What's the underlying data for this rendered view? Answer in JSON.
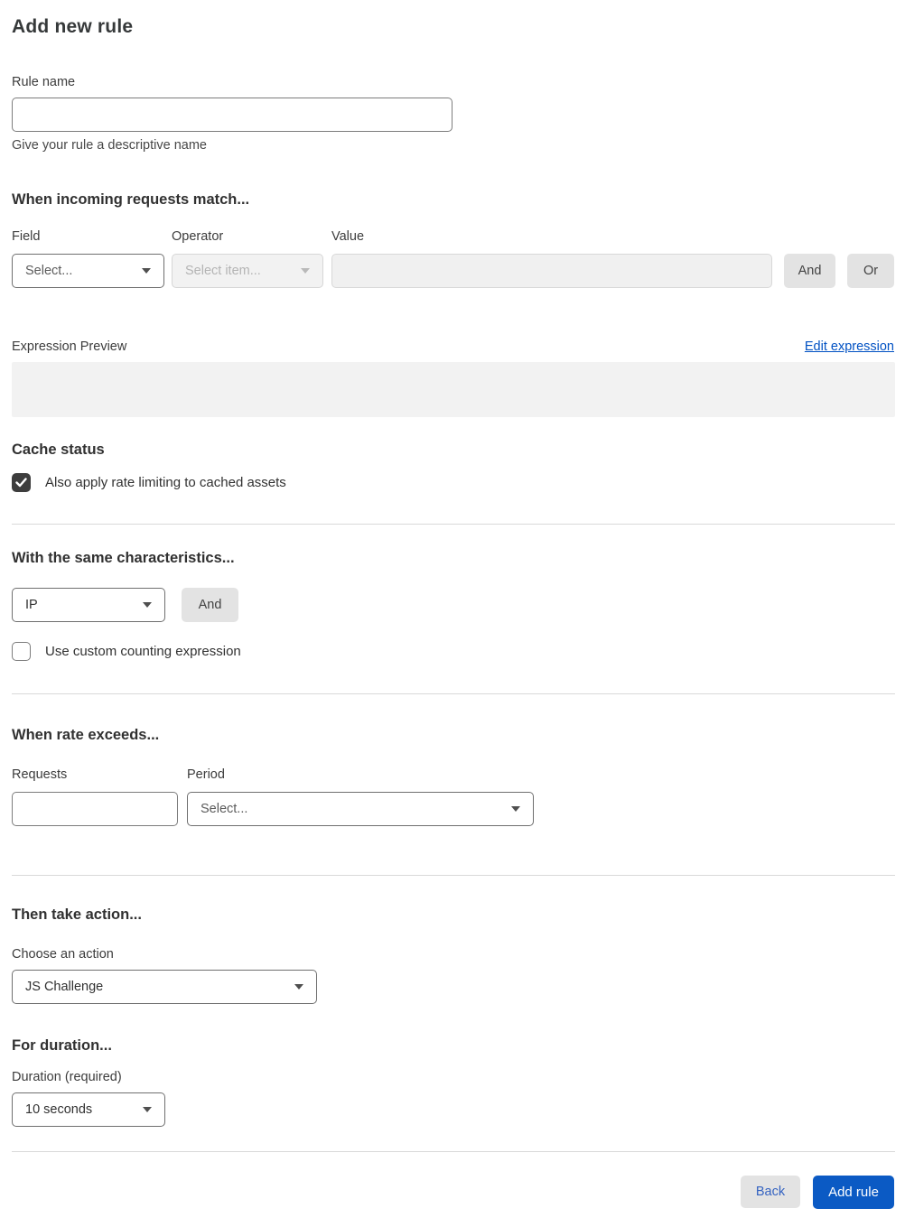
{
  "page": {
    "title": "Add new rule"
  },
  "rule_name": {
    "label": "Rule name",
    "value": "",
    "helper": "Give your rule a descriptive name"
  },
  "match": {
    "heading": "When incoming requests match...",
    "field": {
      "label": "Field",
      "selected": "Select..."
    },
    "operator": {
      "label": "Operator",
      "selected": "Select item...",
      "disabled": true
    },
    "value": {
      "label": "Value",
      "value": "",
      "disabled": true
    },
    "and_button": "And",
    "or_button": "Or"
  },
  "expression": {
    "label": "Expression Preview",
    "edit_link": "Edit expression",
    "content": ""
  },
  "cache": {
    "heading": "Cache status",
    "checkbox_label": "Also apply rate limiting to cached assets",
    "checked": true
  },
  "characteristics": {
    "heading": "With the same characteristics...",
    "select_value": "IP",
    "and_button": "And",
    "checkbox_label": "Use custom counting expression",
    "checked": false
  },
  "rate": {
    "heading": "When rate exceeds...",
    "requests": {
      "label": "Requests",
      "value": ""
    },
    "period": {
      "label": "Period",
      "selected": "Select..."
    }
  },
  "action": {
    "heading": "Then take action...",
    "label": "Choose an action",
    "selected": "JS Challenge"
  },
  "duration": {
    "heading": "For duration...",
    "label": "Duration (required)",
    "selected": "10 seconds"
  },
  "footer": {
    "back_button": "Back",
    "add_button": "Add rule"
  },
  "colors": {
    "accent_blue": "#0b5ac4",
    "link_blue": "#0051c3",
    "checkbox_checked": "#3d3d3d",
    "disabled_bg": "#f2f2f2",
    "divider": "#d9d9d9",
    "button_gray": "#e3e3e3"
  }
}
